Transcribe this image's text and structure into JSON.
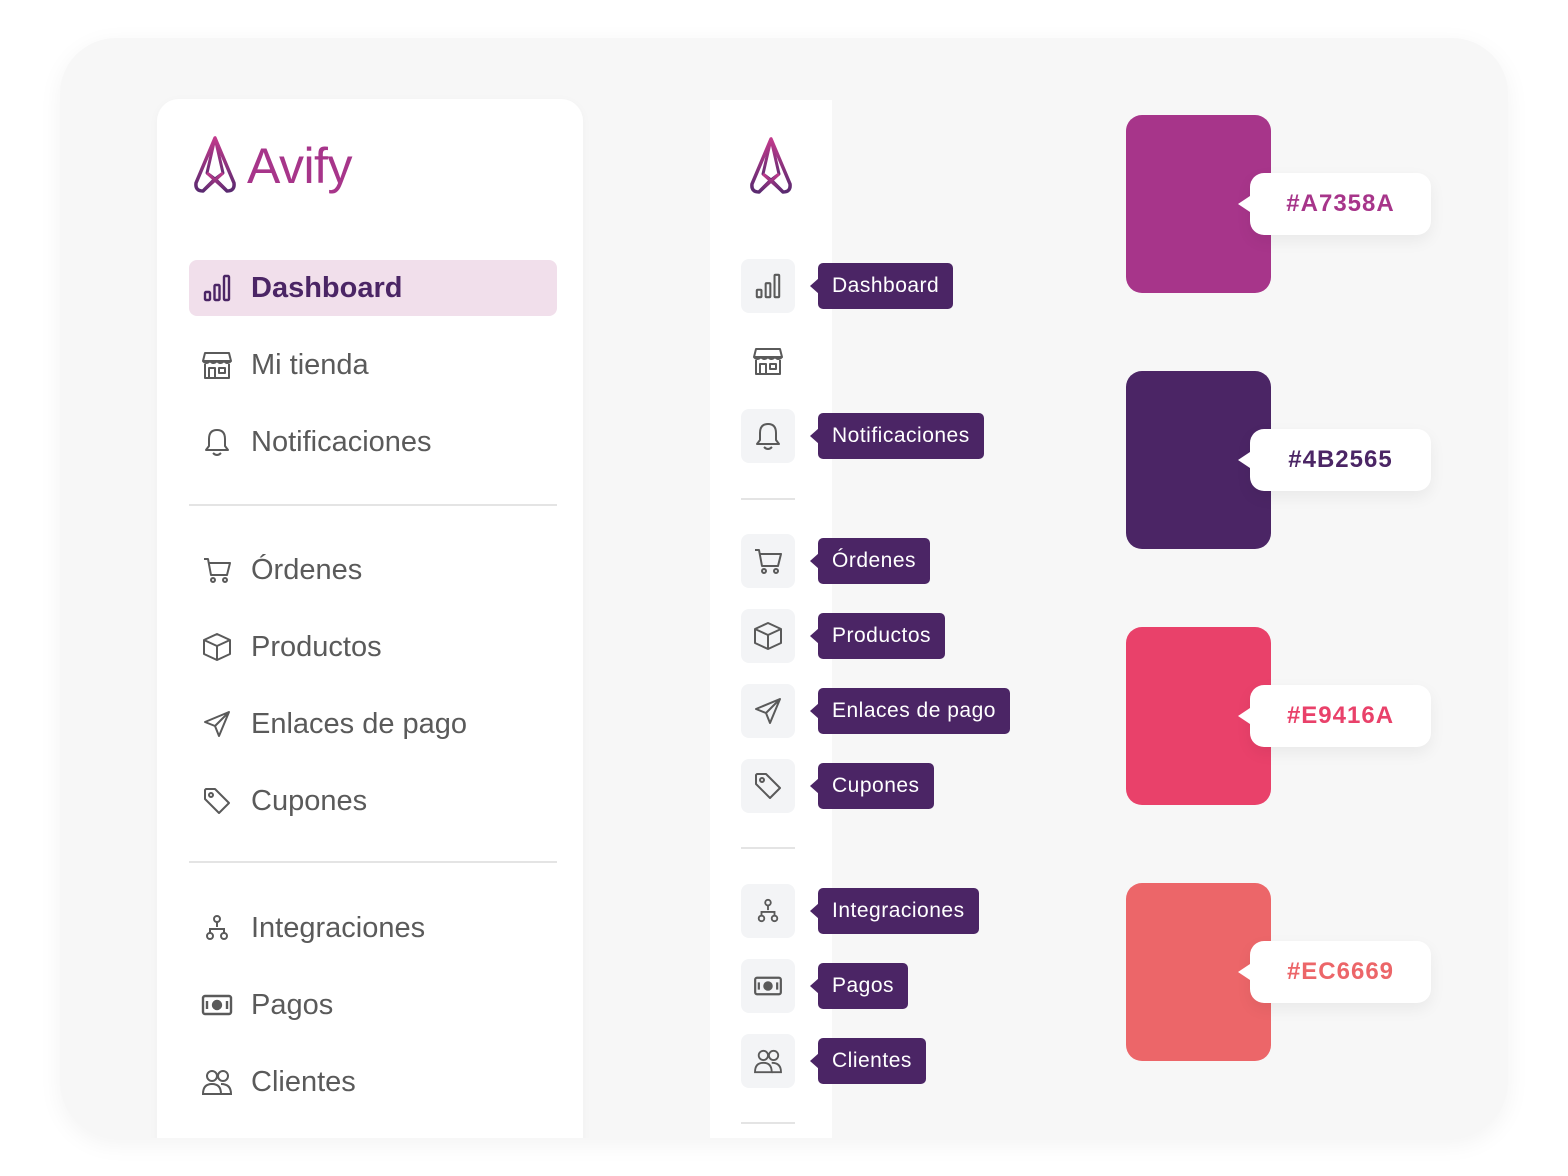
{
  "brand": {
    "name": "Avify",
    "color": "#A7358A"
  },
  "sidebar": {
    "items": [
      {
        "label": "Dashboard",
        "icon": "bar-chart-icon",
        "active": true
      },
      {
        "label": "Mi tienda",
        "icon": "store-icon"
      },
      {
        "label": "Notificaciones",
        "icon": "bell-icon"
      },
      {
        "label": "Órdenes",
        "icon": "cart-icon"
      },
      {
        "label": "Productos",
        "icon": "box-icon"
      },
      {
        "label": "Enlaces de pago",
        "icon": "send-icon"
      },
      {
        "label": "Cupones",
        "icon": "tag-icon"
      },
      {
        "label": "Integraciones",
        "icon": "hierarchy-icon"
      },
      {
        "label": "Pagos",
        "icon": "cash-icon"
      },
      {
        "label": "Clientes",
        "icon": "users-icon"
      }
    ]
  },
  "collapsed": {
    "tooltips": {
      "dashboard": "Dashboard",
      "notificaciones": "Notificaciones",
      "ordenes": "Órdenes",
      "productos": "Productos",
      "enlaces": "Enlaces de pago",
      "cupones": "Cupones",
      "integraciones": "Integraciones",
      "pagos": "Pagos",
      "clientes": "Clientes"
    }
  },
  "palette": [
    {
      "hex": "#A7358A",
      "text_color": "#A7358A"
    },
    {
      "hex": "#4B2565",
      "text_color": "#4B2565"
    },
    {
      "hex": "#E9416A",
      "text_color": "#E9416A"
    },
    {
      "hex": "#EC6669",
      "text_color": "#EC6669"
    }
  ]
}
